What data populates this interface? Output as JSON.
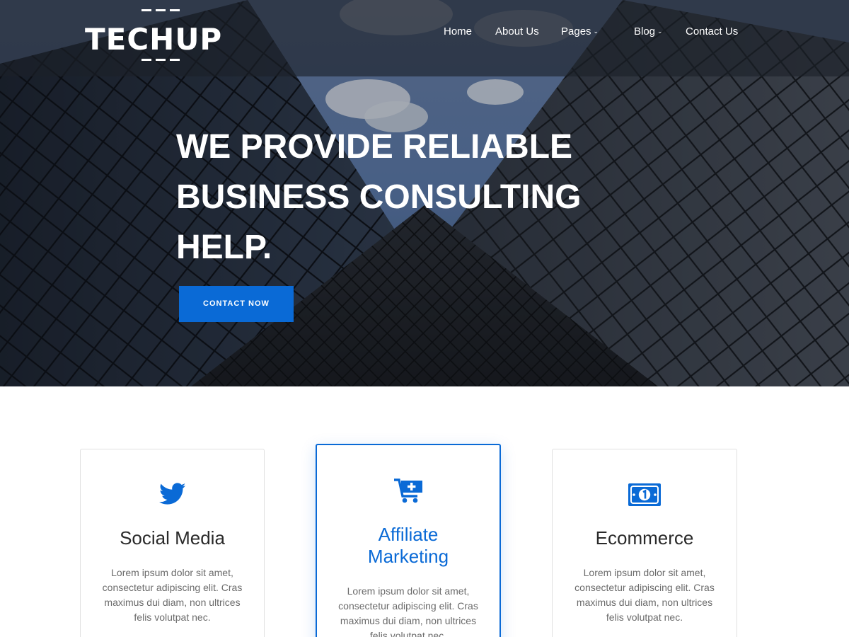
{
  "header": {
    "logo_text": "TECHUP",
    "nav": [
      {
        "label": "Home",
        "has_dropdown": false
      },
      {
        "label": "About Us",
        "has_dropdown": false
      },
      {
        "label": "Pages",
        "has_dropdown": true
      },
      {
        "label": "Blog",
        "has_dropdown": true
      },
      {
        "label": "Contact Us",
        "has_dropdown": false
      }
    ]
  },
  "hero": {
    "title_lines": [
      "WE PROVIDE RELIABLE",
      "BUSINESS CONSULTING",
      "HELP."
    ],
    "cta_label": "CONTACT NOW"
  },
  "services": [
    {
      "icon": "twitter-icon",
      "title": "Social Media",
      "text": "Lorem ipsum dolor sit amet, consectetur adipiscing elit. Cras maximus dui diam, non ultrices felis volutpat nec."
    },
    {
      "icon": "shopping-cart-icon",
      "title": "Affiliate Marketing",
      "text": "Lorem ipsum dolor sit amet, consectetur adipiscing elit. Cras maximus dui diam, non ultrices felis volutpat nec.",
      "active": true
    },
    {
      "icon": "money-bill-icon",
      "title": "Ecommerce",
      "text": "Lorem ipsum dolor sit amet, consectetur adipiscing elit. Cras maximus dui diam, non ultrices felis volutpat nec."
    }
  ],
  "colors": {
    "accent": "#0a6ad6",
    "header_overlay": "#1c2028",
    "heading_text": "#2a2a2a",
    "body_text": "#6b6b6b"
  }
}
